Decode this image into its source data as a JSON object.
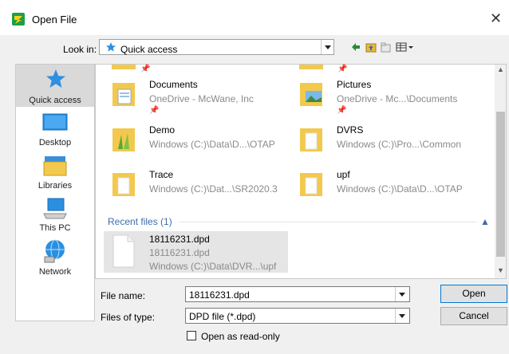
{
  "window": {
    "title": "Open File",
    "close_glyph": "✕"
  },
  "look_in": {
    "label": "Look in:",
    "value": "Quick access"
  },
  "sidebar": {
    "items": [
      {
        "label": "Quick access",
        "icon": "star-icon",
        "selected": true
      },
      {
        "label": "Desktop",
        "icon": "desktop-icon"
      },
      {
        "label": "Libraries",
        "icon": "libraries-icon"
      },
      {
        "label": "This PC",
        "icon": "computer-icon"
      },
      {
        "label": "Network",
        "icon": "network-icon"
      }
    ]
  },
  "folders": [
    {
      "name": "Documents",
      "path": "OneDrive - McWane, Inc",
      "pinned": true
    },
    {
      "name": "Pictures",
      "path": "OneDrive - Mc...\\Documents",
      "pinned": true
    },
    {
      "name": "Demo",
      "path": "Windows (C:)\\Data\\D...\\OTAP"
    },
    {
      "name": "DVRS",
      "path": "Windows (C:)\\Pro...\\Common"
    },
    {
      "name": "Trace",
      "path": "Windows (C:)\\Dat...\\SR2020.3"
    },
    {
      "name": "upf",
      "path": "Windows (C:)\\Data\\D...\\OTAP"
    }
  ],
  "recent": {
    "header": "Recent files (1)",
    "caret": "▲",
    "items": [
      {
        "name": "18116231.dpd",
        "sub": "18116231.dpd",
        "path": "Windows (C:)\\Data\\DVR...\\upf"
      }
    ]
  },
  "form": {
    "file_name_label": "File name:",
    "file_name_value": "18116231.dpd",
    "files_of_type_label": "Files of type:",
    "files_of_type_value": "DPD file (*.dpd)",
    "read_only_label": "Open as read-only",
    "read_only_checked": false,
    "open_label": "Open",
    "cancel_label": "Cancel"
  },
  "colors": {
    "accent": "#0078d7",
    "star": "#2f8fe0",
    "folder": "#f2c94c"
  }
}
